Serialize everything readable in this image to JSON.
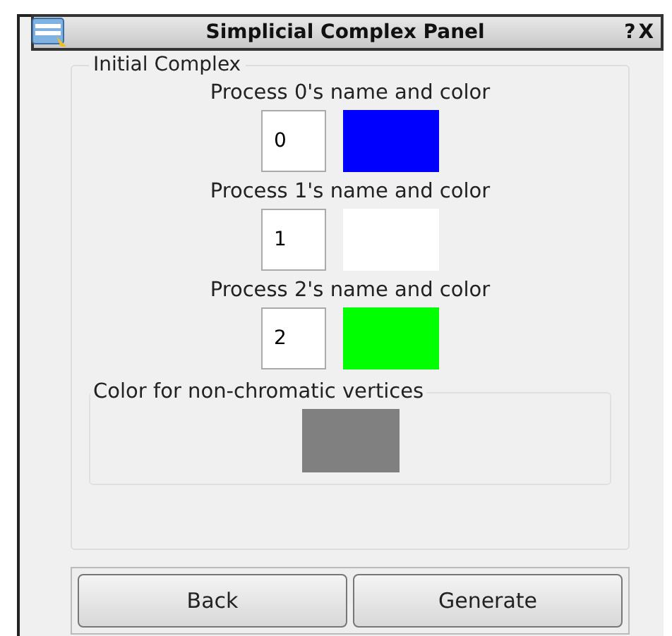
{
  "window": {
    "title": "Simplicial Complex Panel",
    "help": "?",
    "close": "X"
  },
  "group": {
    "title": "Initial Complex",
    "processes": [
      {
        "label": "Process 0's name and color",
        "name": "0",
        "color": "#0000ff"
      },
      {
        "label": "Process 1's name and color",
        "name": "1",
        "color": "#ffffff"
      },
      {
        "label": "Process 2's name and color",
        "name": "2",
        "color": "#00ff00"
      }
    ],
    "non_chromatic": {
      "title": "Color for non-chromatic vertices",
      "color": "#808080"
    }
  },
  "buttons": [
    "Back",
    "Generate"
  ]
}
